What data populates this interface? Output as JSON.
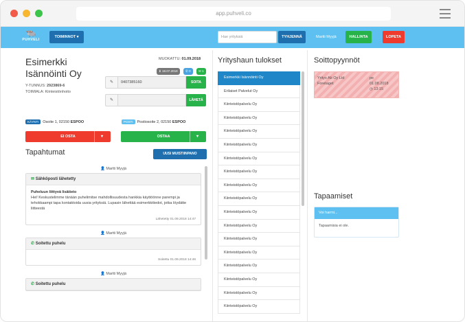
{
  "browser": {
    "url": "app.puhveli.co"
  },
  "topbar": {
    "logo_text": "PUHVELI",
    "toiminnot_label": "TOIMINNOT",
    "search_placeholder": "Hae yrityksiä",
    "clear_label": "TYHJENNÄ",
    "user_name": "Martti Myyjä",
    "hallinta_label": "HALLINTA",
    "logout_label": "LOPETA"
  },
  "company": {
    "name_line1": "Esimerkki",
    "name_line2": "Isännöinti Oy",
    "ytunnus_label": "Y-TUNNUS:",
    "ytunnus_value": "2923869-6",
    "toimiala_label": "TOIMIALA:",
    "toimiala_value": "Kiinteistönhoito",
    "muokattu_label": "MUOKATTU:",
    "muokattu_value": "01.09.2018",
    "badge_date": "18.07.2018",
    "badge_blue": "0",
    "badge_green": "1",
    "phone_value": "0407385160",
    "phone_action": "SOITA",
    "email_value": "",
    "email_action": "LÄHETÄ",
    "addr1_tag": "KÄYNTI",
    "addr1_text": "Osoite 1, 02150",
    "addr1_city": "ESPOO",
    "addr2_tag": "POSTI",
    "addr2_text": "Postiosoite 2, 02150",
    "addr2_city": "ESPOO",
    "ei_osta_label": "EI OSTA",
    "ostaa_label": "OSTAA"
  },
  "events": {
    "title": "Tapahtumat",
    "new_note_label": "UUSI MUISTIINPANO",
    "items": [
      {
        "user": "Martti Myyjä",
        "title": "Sähköposti lähetetty",
        "subject": "Puheluun liittyvä lisätieto",
        "body": "Hei! Keskustelimme tänään puhelimitse mahdollisuudesta hankkia käyttöönne parempi ja tehokkaampi tapa kontaktoida uusia yrityksiä. Lupasin lähettää esimerkkitiedot, jotka löydätte liitteestä",
        "footer": "Lähetetty 01.09.2018 14:47"
      },
      {
        "user": "Martti Myyjä",
        "title": "Soitettu puhelu",
        "footer": "Soitettu 01.09.2018 14:46"
      },
      {
        "user": "Martti Myyjä",
        "title": "Soitettu puhelu"
      }
    ]
  },
  "results": {
    "title": "Yrityshaun tulokset",
    "items": [
      "Esimerkki Isännöinti Oy",
      "Erilaiset Palvelut Oy",
      "Kiinteistöpalvelu Oy",
      "Kiinteistöpalvelu Oy",
      "Kiinteistöpalvelu Oy",
      "Kiinteistöpalvelu Oy",
      "Kiinteistöpalvelu Oy",
      "Kiinteistöpalvelu Oy",
      "Kiinteistöpalvelu Oy",
      "Kiinteistöpalvelu Oy",
      "Kiinteistöpalvelu Oy",
      "Kiinteistöpalvelu Oy",
      "Kiinteistöpalvelu Oy",
      "Kiinteistöpalvelu Oy",
      "Kiinteistöpalvelu Oy",
      "Kiinteistöpalvelu Oy",
      "Kiinteistöpalvelu Oy",
      "Kiinteistöpalvelu Oy"
    ]
  },
  "call_requests": {
    "title": "Soittopyynnöt",
    "company": "Yritys Ab Oy Ltd",
    "contact": "Foretaget",
    "day": "pe",
    "date": "01.08.2018",
    "time": "13:15"
  },
  "meetings": {
    "title": "Tapaamiset",
    "header": "Voi harmi...",
    "empty_text": "Tapaamisia ei ole."
  },
  "colors": {
    "topbar": "#5dc0f0",
    "primary": "#1f6fae",
    "success": "#28b34a",
    "danger": "#ef3b2d"
  }
}
